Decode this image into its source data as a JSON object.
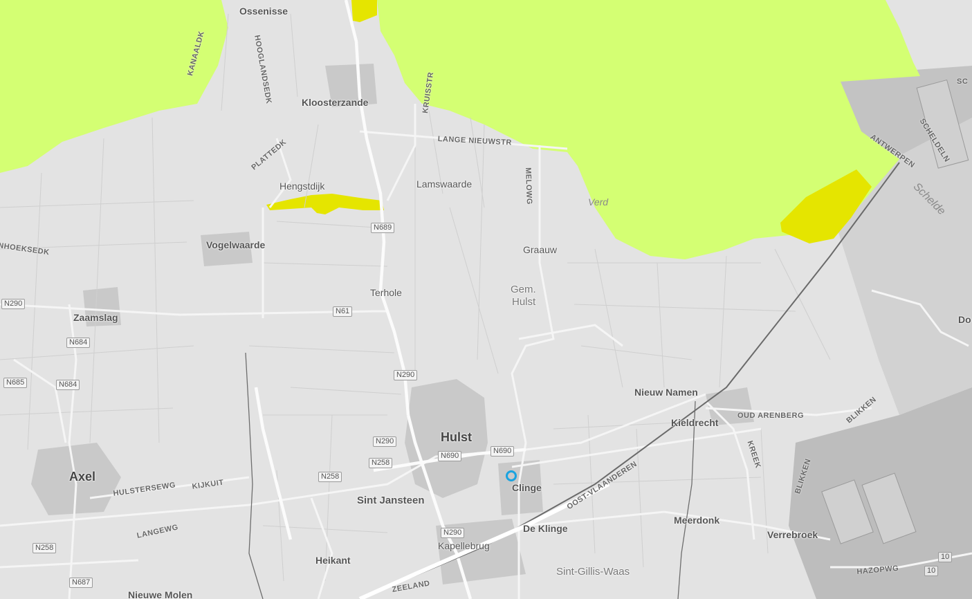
{
  "map": {
    "colors": {
      "land": "#e3e3e3",
      "water_overlay": "#d4ff73",
      "highlight_area": "#e5e500",
      "marker": "#19a3e0",
      "urban": "#c8c8c8"
    },
    "places": {
      "ossenisse": "Ossenisse",
      "kloosterzande": "Kloosterzande",
      "hengstdijk": "Hengstdijk",
      "lamswaarde": "Lamswaarde",
      "vogelwaarde": "Vogelwaarde",
      "graauw": "Graauw",
      "gem_hulst_1": "Gem.",
      "gem_hulst_2": "Hulst",
      "terhole": "Terhole",
      "zaamslag": "Zaamslag",
      "nieuw_namen": "Nieuw Namen",
      "kieldrecht": "Kieldrecht",
      "hulst": "Hulst",
      "axel": "Axel",
      "clinge": "Clinge",
      "sint_jansteen": "Sint Jansteen",
      "de_klinge": "De Klinge",
      "meerdonk": "Meerdonk",
      "verrebroek": "Verrebroek",
      "kapellebrug": "Kapellebrug",
      "heikant": "Heikant",
      "sint_gillis_waas": "Sint-Gillis-Waas",
      "nieuwe_molen": "Nieuwe Molen",
      "do": "Do",
      "verd": "Verd"
    },
    "roads": {
      "kanaaldk": "KANAALDK",
      "hooglandsedk": "HOOGLANDSEDK",
      "plattedk": "PLATTEDK",
      "kruisstr": "KRUISSTR",
      "lange_nieuwstr": "LANGE NIEUWSTR",
      "melowg": "MELOWG",
      "nhoeksedk": "NHOEKSEDK",
      "antwerpen": "ANTWERPEN",
      "scheldeln": "SCHELDELN",
      "sc": "SC",
      "oud_arenberg": "OUD ARENBERG",
      "blikken_1": "BLIKKEN",
      "blikken_2": "BLIKKEN",
      "kreek": "KREEK",
      "oost_vlaanderen": "OOST-VLAANDEREN",
      "hulstersewg": "HULSTERSEWG",
      "kijkuit": "KIJKUIT",
      "langewg": "LANGEWG",
      "zeeland": "ZEELAND",
      "hazopwg": "HAZOPWG",
      "schelde": "Schelde"
    },
    "shields": {
      "n689": "N689",
      "n290_w": "N290",
      "n61": "N61",
      "n684_a": "N684",
      "n684_b": "N684",
      "n685": "N685",
      "n290_c": "N290",
      "n290_h": "N290",
      "n258_a": "N258",
      "n690_a": "N690",
      "n690_b": "N690",
      "n258_b": "N258",
      "n290_s": "N290",
      "n258_c": "N258",
      "n687": "N687",
      "a10_a": "10",
      "a10_b": "10"
    }
  }
}
